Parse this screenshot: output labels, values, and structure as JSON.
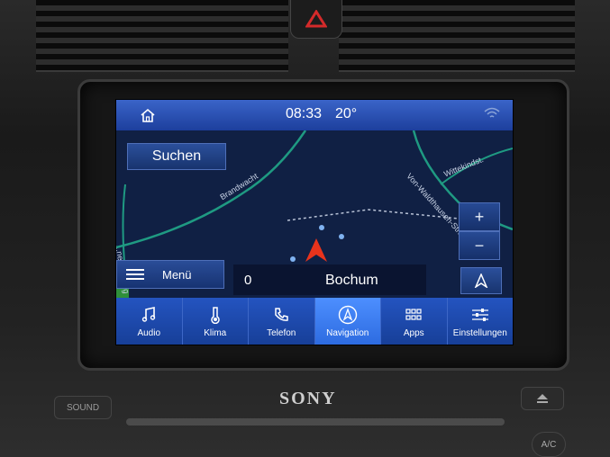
{
  "status_bar": {
    "time": "08:33",
    "temperature": "20°"
  },
  "map": {
    "search_label": "Suchen",
    "zoom_in": "+",
    "zoom_out": "−",
    "road_labels": [
      "Brandwacht",
      "Von-Waldthausen-Straße",
      "Wittekindst.",
      "...ner Hellweg"
    ],
    "menu_label": "Menü",
    "route": {
      "distance": "0",
      "destination": "Bochum"
    }
  },
  "nav": [
    {
      "label": "Audio",
      "icon": "music-note-icon"
    },
    {
      "label": "Klima",
      "icon": "thermometer-icon"
    },
    {
      "label": "Telefon",
      "icon": "phone-icon"
    },
    {
      "label": "Navigation",
      "icon": "navigation-icon",
      "active": true
    },
    {
      "label": "Apps",
      "icon": "apps-grid-icon"
    },
    {
      "label": "Einstellungen",
      "icon": "settings-sliders-icon"
    }
  ],
  "hardware": {
    "brand": "SONY",
    "sound_label": "SOUND",
    "ac_label": "A/C"
  },
  "colors": {
    "accent": "#2d6be0",
    "status_bar": "#2a55b8",
    "map_bg": "#102044",
    "map_road": "#1f9a82",
    "arrow": "#e8331c"
  }
}
